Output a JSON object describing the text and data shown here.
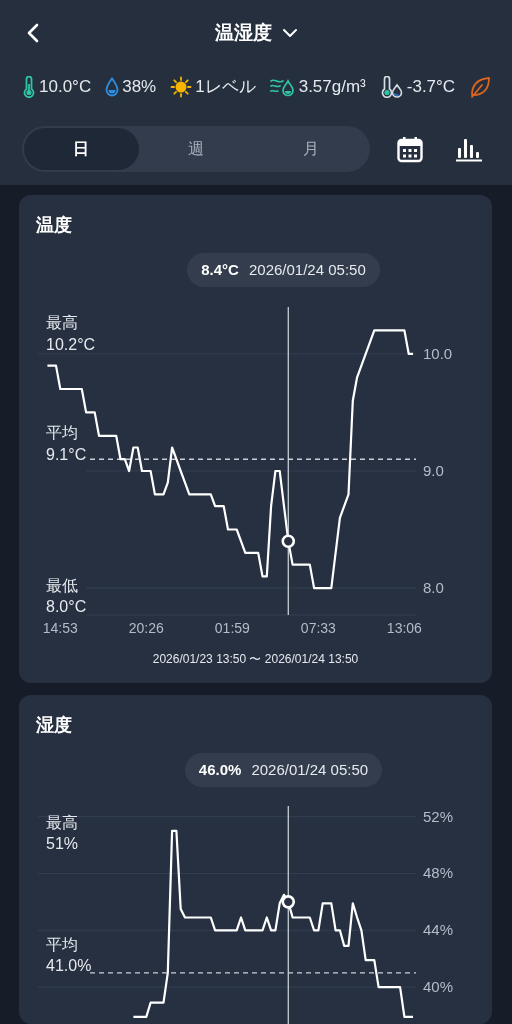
{
  "header": {
    "title": "温湿度"
  },
  "metrics": [
    {
      "kind": "temperature",
      "value": "10.0°C"
    },
    {
      "kind": "humidity",
      "value": "38%"
    },
    {
      "kind": "light",
      "value": "1レベル"
    },
    {
      "kind": "absolute_humidity",
      "value": "3.57g/m³"
    },
    {
      "kind": "dew_point",
      "value": "-3.7°C"
    },
    {
      "kind": "leaf"
    }
  ],
  "tabs": [
    {
      "label": "日",
      "selected": true
    },
    {
      "label": "週",
      "selected": false
    },
    {
      "label": "月",
      "selected": false
    }
  ],
  "cards": [
    {
      "title": "温度",
      "tooltip": {
        "value": "8.4°C",
        "time": "2026/01/24 05:50"
      },
      "stats": [
        {
          "label": "最高",
          "value": "10.2°C"
        },
        {
          "label": "平均"
        },
        {
          "label": "最低",
          "value": "8.0°C"
        }
      ],
      "chart_data": {
        "type": "line",
        "categories": [
          null,
          null,
          null,
          "14:53",
          null,
          null,
          null,
          null,
          null,
          null,
          null,
          null,
          null,
          null,
          null,
          null,
          null,
          null,
          null,
          null,
          null,
          null,
          null,
          "20:26",
          null,
          null,
          null,
          null,
          null,
          null,
          null,
          null,
          null,
          null,
          null,
          null,
          null,
          null,
          null,
          null,
          null,
          null,
          null,
          "01:59",
          null,
          null,
          null,
          null,
          null,
          null,
          null,
          null,
          null,
          null,
          null,
          null,
          null,
          null,
          null,
          null,
          null,
          null,
          null,
          "07:33",
          null,
          null,
          null,
          null,
          null,
          null,
          null,
          null,
          null,
          null,
          null,
          null,
          null,
          null,
          null,
          null,
          null,
          null,
          null,
          "13:06",
          null,
          null
        ],
        "series": [
          {
            "color": "#ffffff",
            "values": [
              9.9,
              9.9,
              9.9,
              9.7,
              9.7,
              9.7,
              9.7,
              9.7,
              9.7,
              9.5,
              9.5,
              9.5,
              9.3,
              9.3,
              9.3,
              9.3,
              9.3,
              9.1,
              9.1,
              9.0,
              9.2,
              9.2,
              9.0,
              9.0,
              9.0,
              8.8,
              8.8,
              8.8,
              8.9,
              9.2,
              9.1,
              9.0,
              8.9,
              8.8,
              8.8,
              8.8,
              8.8,
              8.8,
              8.8,
              8.7,
              8.7,
              8.7,
              8.5,
              8.5,
              8.5,
              8.4,
              8.3,
              8.3,
              8.3,
              8.3,
              8.1,
              8.1,
              8.7,
              9.0,
              9.0,
              8.7,
              8.4,
              8.2,
              8.2,
              8.2,
              8.2,
              8.2,
              8.0,
              8.0,
              8.0,
              8.0,
              8.0,
              8.3,
              8.6,
              8.7,
              8.8,
              9.6,
              9.8,
              9.9,
              10.0,
              10.1,
              10.2,
              10.2,
              10.2,
              10.2,
              10.2,
              10.2,
              10.2,
              10.2,
              10.0,
              10.0
            ]
          }
        ],
        "ylim": [
          7.77,
          10.4
        ],
        "yticks": [
          {
            "value": 8,
            "label": "8.0"
          },
          {
            "value": 9,
            "label": "9.0"
          },
          {
            "value": 10,
            "label": "10.0"
          }
        ],
        "grid": true,
        "ref_lines": [
          {
            "axis": "y",
            "value": 9.1,
            "label": "9.1°C"
          }
        ]
      },
      "footer": "2026/01/23 13:50 〜 2026/01/24 13:50"
    },
    {
      "title": "湿度",
      "tooltip": {
        "value": "46.0%",
        "time": "2026/01/24 05:50"
      },
      "stats": [
        {
          "label": "最高",
          "value": "51%"
        },
        {
          "label": "平均"
        }
      ],
      "chart_data": {
        "type": "line",
        "categories": [
          null,
          null,
          null,
          null,
          null,
          null,
          null,
          null,
          null,
          null,
          null,
          null,
          null,
          null,
          null,
          null,
          null,
          null,
          null,
          null,
          null,
          null,
          null,
          null,
          null,
          null,
          null,
          null,
          null,
          null,
          null,
          null,
          null,
          null,
          null,
          null,
          null,
          null,
          null,
          null,
          null,
          null,
          null,
          null,
          null,
          null,
          null,
          null,
          null,
          null,
          null,
          null,
          null,
          null,
          null,
          null,
          null,
          null,
          null,
          null,
          null,
          null,
          null,
          null,
          null,
          null,
          null,
          null,
          null,
          null,
          null,
          null,
          null,
          null,
          null,
          null,
          null,
          null,
          null,
          null,
          null,
          null,
          null,
          null,
          null,
          null
        ],
        "series": [
          {
            "color": "#ffffff",
            "values": [
              null,
              null,
              null,
              null,
              null,
              null,
              null,
              null,
              null,
              null,
              null,
              null,
              null,
              null,
              null,
              null,
              null,
              null,
              null,
              null,
              37.9,
              37.9,
              37.9,
              37.9,
              38.9,
              38.9,
              38.9,
              38.9,
              41.0,
              51.0,
              51.0,
              45.5,
              44.9,
              44.9,
              44.9,
              44.9,
              44.9,
              44.9,
              44.9,
              44.0,
              44.0,
              44.0,
              44.0,
              44.0,
              44.0,
              44.9,
              44.0,
              44.0,
              44.0,
              44.0,
              44.0,
              44.9,
              44.0,
              44.0,
              45.9,
              46.5,
              46.0,
              44.9,
              44.9,
              44.9,
              44.9,
              44.9,
              44.0,
              44.0,
              45.9,
              45.9,
              45.9,
              44.0,
              44.0,
              42.9,
              42.9,
              45.9,
              44.9,
              44.0,
              41.9,
              41.9,
              41.9,
              40.0,
              40.0,
              40.0,
              40.0,
              40.0,
              40.0,
              37.9,
              37.9,
              37.9
            ]
          }
        ],
        "ylim": [
          37.4,
          52.75
        ],
        "yticks": [
          {
            "value": 40,
            "label": "40%"
          },
          {
            "value": 44,
            "label": "44%"
          },
          {
            "value": 48,
            "label": "48%"
          },
          {
            "value": 52,
            "label": "52%"
          }
        ],
        "grid": true,
        "ref_lines": [
          {
            "axis": "y",
            "value": 41.0,
            "label": "41.0%"
          }
        ]
      }
    }
  ]
}
